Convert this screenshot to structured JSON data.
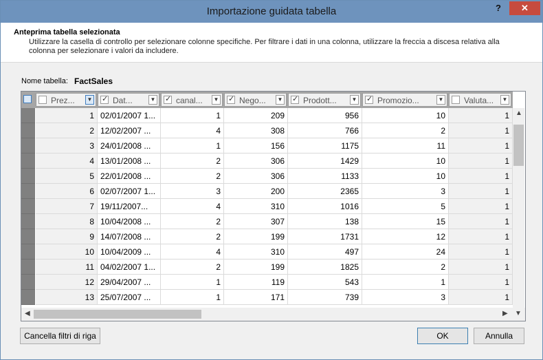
{
  "window": {
    "title": "Importazione guidata tabella",
    "help_label": "?",
    "close_label": "✕"
  },
  "header": {
    "title": "Anteprima tabella selezionata",
    "description": "Utilizzare la casella di controllo per selezionare colonne specifiche. Per filtrare i dati in una colonna, utilizzare la freccia a discesa relativa alla colonna per selezionare i valori da includere."
  },
  "table_name": {
    "label": "Nome tabella:",
    "value": "FactSales"
  },
  "columns": [
    {
      "label": "Prez...",
      "checked": false,
      "align": "num"
    },
    {
      "label": "Dat...",
      "checked": true,
      "align": "txt"
    },
    {
      "label": "canal...",
      "checked": true,
      "align": "num"
    },
    {
      "label": "Nego...",
      "checked": true,
      "align": "num"
    },
    {
      "label": "Prodott...",
      "checked": true,
      "align": "num"
    },
    {
      "label": "Promozio...",
      "checked": true,
      "align": "num"
    },
    {
      "label": "Valuta...",
      "checked": false,
      "align": "num"
    }
  ],
  "rows": [
    [
      "1",
      "02/01/2007 1...",
      "1",
      "209",
      "956",
      "10",
      "1"
    ],
    [
      "2",
      "12/02/2007 ...",
      "4",
      "308",
      "766",
      "2",
      "1"
    ],
    [
      "3",
      "24/01/2008 ...",
      "1",
      "156",
      "1175",
      "11",
      "1"
    ],
    [
      "4",
      "13/01/2008 ...",
      "2",
      "306",
      "1429",
      "10",
      "1"
    ],
    [
      "5",
      "22/01/2008 ...",
      "2",
      "306",
      "1133",
      "10",
      "1"
    ],
    [
      "6",
      "02/07/2007 1...",
      "3",
      "200",
      "2365",
      "3",
      "1"
    ],
    [
      "7",
      "19/11/2007...",
      "4",
      "310",
      "1016",
      "5",
      "1"
    ],
    [
      "8",
      "10/04/2008 ...",
      "2",
      "307",
      "138",
      "15",
      "1"
    ],
    [
      "9",
      "14/07/2008 ...",
      "2",
      "199",
      "1731",
      "12",
      "1"
    ],
    [
      "10",
      "10/04/2009 ...",
      "4",
      "310",
      "497",
      "24",
      "1"
    ],
    [
      "11",
      "04/02/2007 1...",
      "2",
      "199",
      "1825",
      "2",
      "1"
    ],
    [
      "12",
      "29/04/2007 ...",
      "1",
      "119",
      "543",
      "1",
      "1"
    ],
    [
      "13",
      "25/07/2007 ...",
      "1",
      "171",
      "739",
      "3",
      "1"
    ]
  ],
  "buttons": {
    "clear_filters": "Cancella filtri di riga",
    "ok": "OK",
    "cancel": "Annulla"
  }
}
